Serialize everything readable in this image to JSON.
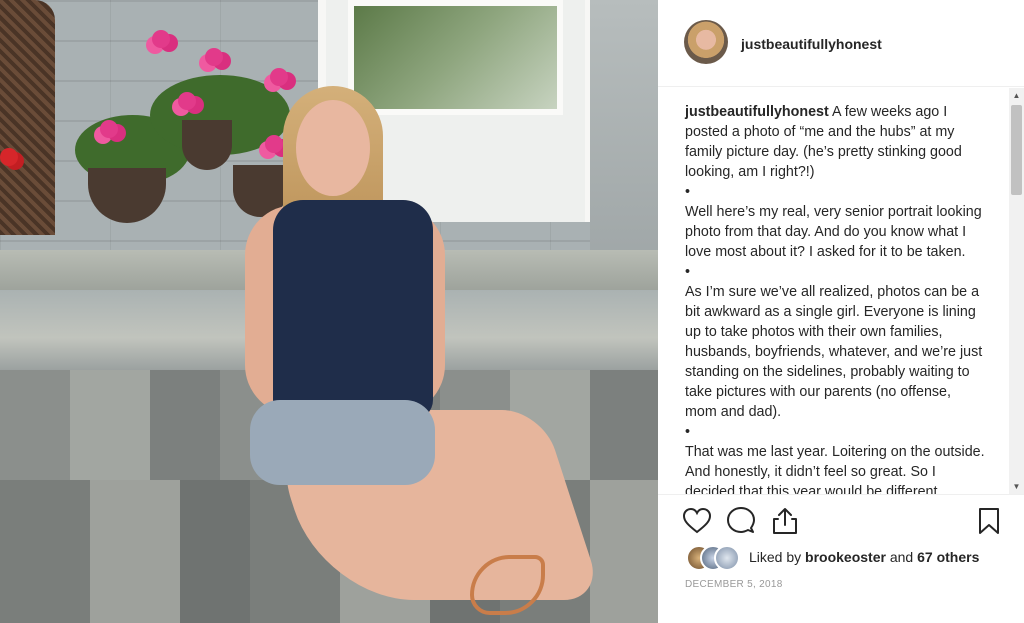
{
  "post": {
    "username": "justbeautifullyhonest",
    "caption_username": "justbeautifullyhonest",
    "paragraphs": [
      "A few weeks ago I posted a photo of “me and the hubs” at my family picture day. (he’s pretty stinking good looking, am I right?!)",
      "Well here’s my real, very senior portrait looking photo from that day. And do you know what I love most about it? I asked for it to be taken.",
      "As I’m sure we’ve all realized, photos can be a bit awkward as a single girl. Everyone is lining up to take photos with their own families, husbands, boyfriends, whatever, and we’re just standing on the sidelines, probably waiting to take pictures with our parents (no offense, mom and dad).",
      "That was me last year. Loitering on the outside. And honestly, it didn’t feel so great. So I decided that this year would be different."
    ],
    "bullet": "•",
    "likes": {
      "prefix": "Liked by",
      "user": "brookeoster",
      "middle": "and",
      "others": "67 others"
    },
    "date": "December 5, 2018"
  },
  "icons": {
    "like": "heart-icon",
    "comment": "comment-icon",
    "share": "share-icon",
    "save": "bookmark-icon"
  },
  "colors": {
    "text": "#262626",
    "muted": "#999999",
    "divider": "#efefef"
  }
}
